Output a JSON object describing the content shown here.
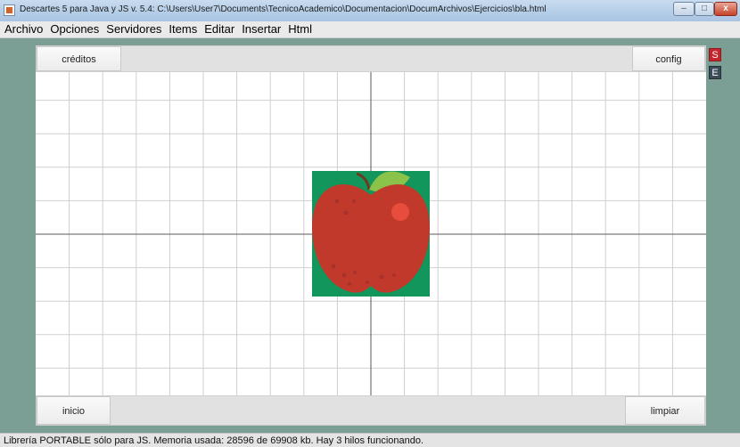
{
  "window": {
    "title": "Descartes 5 para Java y JS v. 5.4: C:\\Users\\User7\\Documents\\TecnicoAcademico\\Documentacion\\DocumArchivos\\Ejercicios\\bla.html",
    "controls": {
      "minimize": "–",
      "maximize": "□",
      "close": "x"
    }
  },
  "menu": {
    "items": [
      "Archivo",
      "Opciones",
      "Servidores",
      "Items",
      "Editar",
      "Insertar",
      "Html"
    ]
  },
  "scene": {
    "top_buttons": {
      "left": "créditos",
      "right": "config"
    },
    "bottom_buttons": {
      "left": "inicio",
      "right": "limpiar"
    },
    "side_buttons": {
      "s": "S",
      "e": "E"
    },
    "image": {
      "name": "apple-image",
      "bg_color": "#12965c",
      "apple_color": "#c0392b",
      "leaf_color": "#8bc34a"
    }
  },
  "status": {
    "text": "Librería PORTABLE sólo para JS. Memoria usada: 28596 de 69908 kb. Hay 3 hilos funcionando."
  }
}
